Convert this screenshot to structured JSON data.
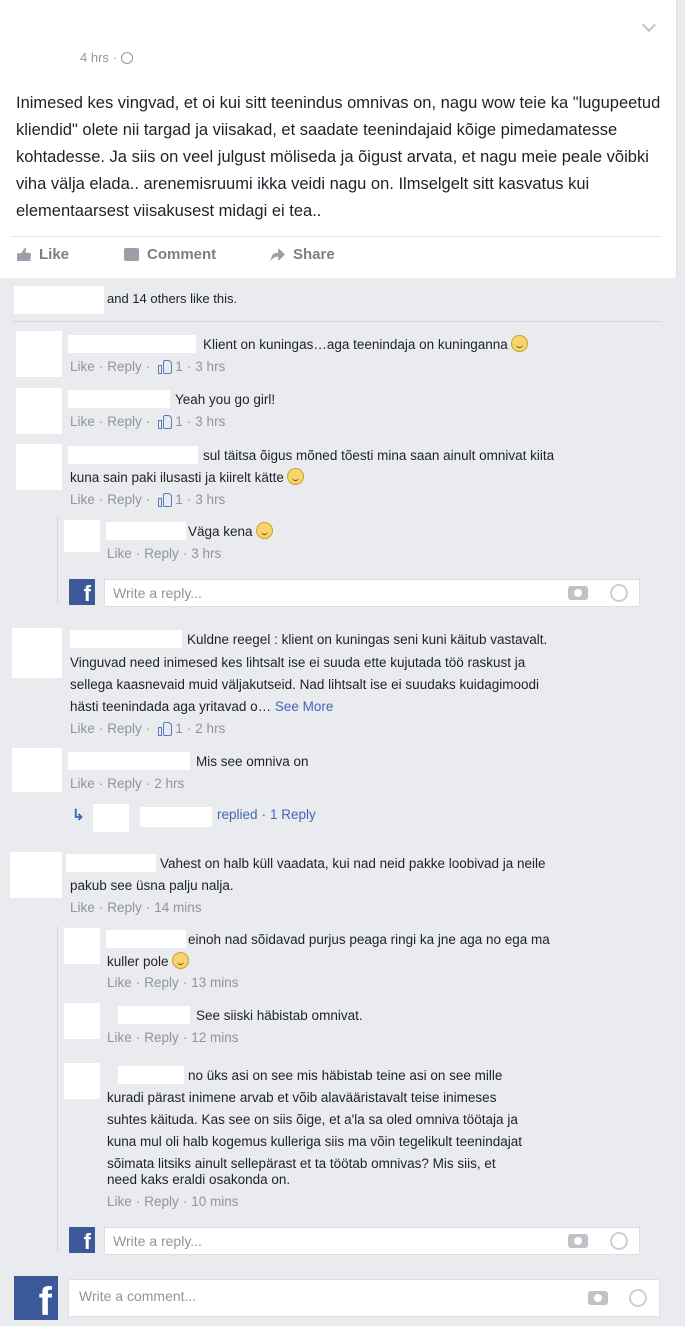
{
  "post": {
    "time": "4 hrs",
    "text": "Inimesed kes vingvad, et oi kui sitt teenindus omnivas on, nagu wow teie ka \"lugupeetud kliendid\" olete nii targad ja viisakad, et saadate teenindajaid kõige pimedamatesse kohtadesse. Ja siis on veel julgust möliseda ja õigust arvata, et nagu meie peale võibki viha välja elada.. arenemisruumi ikka veidi nagu on. Ilmselgelt sitt kasvatus kui elementaarsest viisakusest midagi ei tea..",
    "actions": {
      "like": "Like",
      "comment": "Comment",
      "share": "Share"
    }
  },
  "likes_text": "and 14 others like this.",
  "labels": {
    "like": "Like",
    "reply": "Reply",
    "sep": "·",
    "see_more": "See More",
    "replied": "replied",
    "one_reply": "1 Reply"
  },
  "comments": [
    {
      "text": "Klient on kuningas…aga teenindaja on kuninganna",
      "likes": "1",
      "time": "3 hrs"
    },
    {
      "text": "Yeah you go girl!",
      "likes": "1",
      "time": "3 hrs"
    },
    {
      "text": "sul täitsa õigus mõned tõesti mina saan ainult omnivat kiita",
      "text2": "kuna sain paki ilusasti ja kiirelt kätte",
      "likes": "1",
      "time": "3 hrs",
      "replies": [
        {
          "text": "Väga kena",
          "time": "3 hrs"
        }
      ]
    },
    {
      "text": "Kuldne reegel : klient on kuningas seni kuni käitub vastavalt.",
      "text2": "Vinguvad need inimesed kes lihtsalt ise ei suuda ette kujutada töö raskust ja",
      "text3": "sellega kaasnevaid muid väljakutseid. Nad lihtsalt ise ei suudaks kuidagimoodi",
      "text4": "hästi teenindada aga yritavad o…",
      "likes": "1",
      "time": "2 hrs"
    },
    {
      "text": "Mis see omniva on",
      "time": "2 hrs"
    },
    {
      "text": "Vahest on halb küll vaadata, kui nad neid pakke loobivad ja neile",
      "text2": "pakub see üsna palju nalja.",
      "time": "14 mins",
      "replies": [
        {
          "text": "einoh nad sõidavad purjus peaga ringi ka jne aga no ega ma",
          "text2": "kuller pole",
          "time": "13 mins"
        },
        {
          "text": "See siiski häbistab omnivat.",
          "time": "12 mins"
        },
        {
          "text": "no üks asi on see mis häbistab teine asi on see mille",
          "text2": "kuradi pärast inimene arvab et võib alavääristavalt teise inimeses",
          "text3": "suhtes käituda. Kas see on siis õige, et a'la sa oled omniva töötaja ja",
          "text4": "kuna mul oli halb kogemus kulleriga siis ma võin tegelikult teenindajat",
          "text5": "sõimata litsiks ainult sellepärast et ta töötab omnivas? Mis siis, et",
          "text6": "need kaks eraldi osakonda on.",
          "time": "10 mins"
        }
      ]
    }
  ],
  "reply_placeholder": "Write a reply...",
  "comment_placeholder": "Write a comment...",
  "colors": {
    "brand": "#3b5998",
    "link": "#4267b2",
    "muted": "#90949c",
    "background": "#e9ebee"
  },
  "icons": [
    "globe-icon",
    "chevron-down-icon",
    "like-icon",
    "comment-icon",
    "share-icon",
    "thumbs-up-icon",
    "smiley-icon",
    "camera-icon",
    "emoji-icon",
    "facebook-logo-icon",
    "reply-arrow-icon"
  ]
}
